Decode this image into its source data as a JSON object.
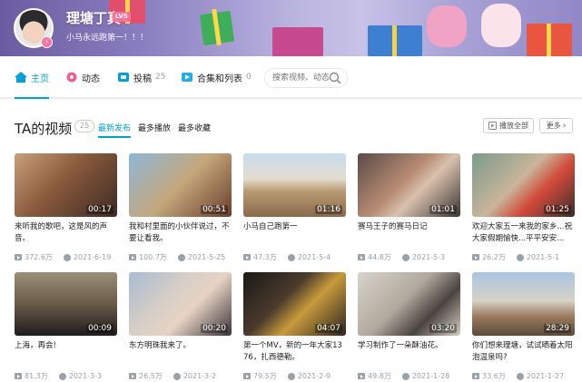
{
  "header": {
    "username": "理塘丁真",
    "level": "LV5",
    "signature": "小马永远跑第一！！！"
  },
  "nav": {
    "tabs": [
      {
        "label": "主页",
        "count": "",
        "icon": "home-icon"
      },
      {
        "label": "动态",
        "count": "",
        "icon": "activity-icon"
      },
      {
        "label": "投稿",
        "count": "25",
        "icon": "upload-icon"
      },
      {
        "label": "合集和列表",
        "count": "0",
        "icon": "collection-icon"
      }
    ],
    "search_placeholder": "搜索视频、动态"
  },
  "section": {
    "title": "TA的视频",
    "count": "25",
    "sorts": [
      "最新发布",
      "最多播放",
      "最多收藏"
    ],
    "play_all": "播放全部",
    "more": "更多"
  },
  "videos": [
    {
      "title": "来听我的歌吧，这是风的声音。",
      "duration": "00:17",
      "views": "372.6万",
      "date": "2021-6-19"
    },
    {
      "title": "我和村里面的小伙伴说过，不要让看我。",
      "duration": "00:51",
      "views": "100.7万",
      "date": "2021-5-25"
    },
    {
      "title": "小马自己跑第一",
      "duration": "01:16",
      "views": "47.3万",
      "date": "2021-5-4"
    },
    {
      "title": "赛马王子的赛马日记",
      "duration": "01:01",
      "views": "44.8万",
      "date": "2021-5-3"
    },
    {
      "title": "欢迎大家五一来我的家乡...祝大家假期愉快...平平安安...",
      "duration": "01:25",
      "views": "26.2万",
      "date": "2021-5-1"
    },
    {
      "title": "上海，再会!",
      "duration": "00:09",
      "views": "81.3万",
      "date": "2021-3-3"
    },
    {
      "title": "东方明珠我来了。",
      "duration": "00:20",
      "views": "26.5万",
      "date": "2021-3-2"
    },
    {
      "title": "第一个MV，新的一年大家1376，扎西德勒。",
      "duration": "04:07",
      "views": "79.5万",
      "date": "2021-2-9"
    },
    {
      "title": "学习制作了一朵酥油花。",
      "duration": "03:20",
      "views": "49.8万",
      "date": "2021-1-28"
    },
    {
      "title": "你们想来理塘，试试晒着太阳泡温泉吗?",
      "duration": "28:29",
      "views": "33.6万",
      "date": "2021-1-27"
    }
  ],
  "colors": {
    "accent": "#00a1d6",
    "pink": "#fb7299",
    "muted": "#99a2aa"
  }
}
